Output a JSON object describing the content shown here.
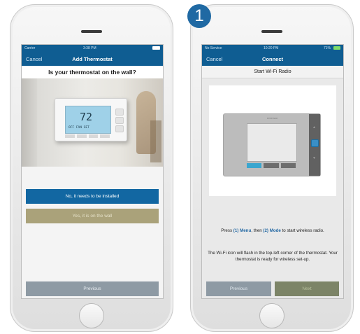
{
  "step_badge": "1",
  "left_phone": {
    "status": {
      "carrier": "Carrier",
      "time": "3:38 PM"
    },
    "nav": {
      "cancel": "Cancel",
      "title": "Add Thermostat"
    },
    "question": "Is your thermostat on the wall?",
    "thermostat_display": {
      "temp": "72",
      "line": "OFF  FAN  SET"
    },
    "buttons": {
      "install": "No, it needs to be installed",
      "on_wall": "Yes, it is on the wall",
      "previous": "Previous"
    }
  },
  "right_phone": {
    "status": {
      "carrier": "No Service",
      "time": "10:20 PM",
      "battery": "71%"
    },
    "nav": {
      "cancel": "Cancel",
      "title": "Connect"
    },
    "step_title": "Start Wi-Fi Radio",
    "device_brand": "emerson",
    "instruction": {
      "pre": "Press ",
      "menu": "(1) Menu",
      "mid": ", then ",
      "mode": "(2) Mode",
      "post": " to start wireless radio."
    },
    "note": "The Wi-Fi icon will flash in the top-left corner of the thermostat. Your thermostat is ready for wireless set-up.",
    "buttons": {
      "previous": "Previous",
      "next": "Next"
    }
  }
}
